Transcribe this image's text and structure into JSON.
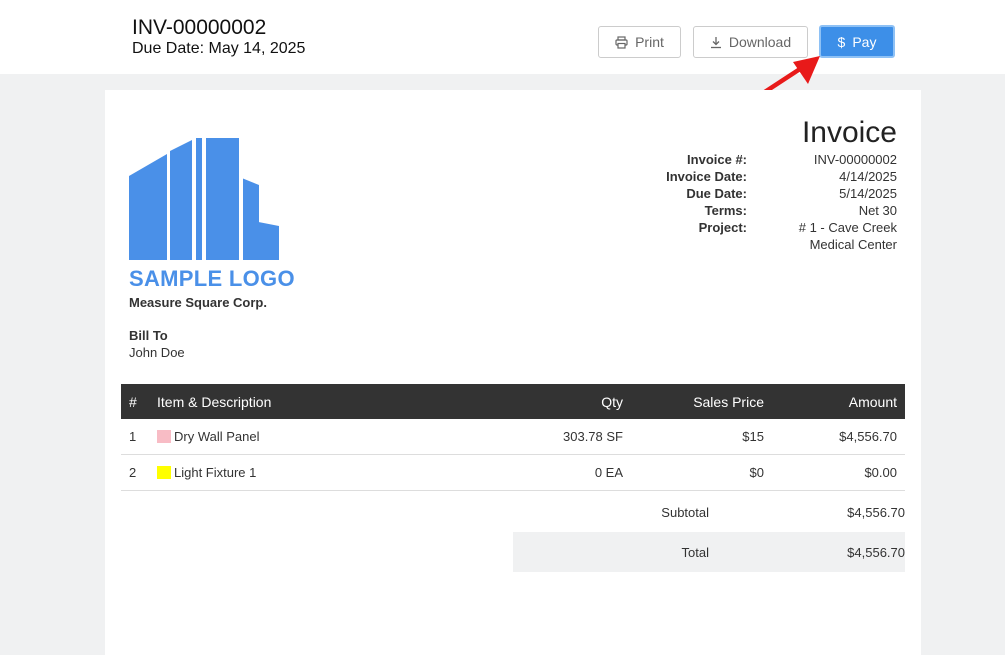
{
  "header": {
    "invoice_id": "INV-00000002",
    "due_date": "Due Date: May 14, 2025",
    "buttons": {
      "print": "Print",
      "download": "Download",
      "pay": "Pay"
    }
  },
  "icons": {
    "print": "printer-icon",
    "download": "download-icon",
    "pay": "dollar-icon"
  },
  "colors": {
    "primary": "#3d8fe8",
    "logo": "#4a90e8",
    "arrow": "#e81a1a",
    "table_header": "#333333"
  },
  "document": {
    "logo_text": "SAMPLE LOGO",
    "company": "Measure Square Corp.",
    "bill_to_label": "Bill To",
    "bill_to_name": "John Doe",
    "title": "Invoice",
    "meta": [
      {
        "label": "Invoice #:",
        "value": "INV-00000002"
      },
      {
        "label": "Invoice Date:",
        "value": "4/14/2025"
      },
      {
        "label": "Due Date:",
        "value": "5/14/2025"
      },
      {
        "label": "Terms:",
        "value": "Net 30"
      },
      {
        "label": "Project:",
        "value": "# 1 - Cave Creek"
      },
      {
        "label": "",
        "value": "Medical Center"
      }
    ]
  },
  "table": {
    "headers": [
      "#",
      "Item & Description",
      "Qty",
      "Sales Price",
      "Amount"
    ],
    "rows": [
      {
        "num": "1",
        "item": "Dry Wall Panel",
        "swatch": "#f8bcc5",
        "qty": "303.78 SF",
        "price": "$15",
        "amount": "$4,556.70"
      },
      {
        "num": "2",
        "item": "Light Fixture 1",
        "swatch": "#ffff00",
        "qty": "0 EA",
        "price": "$0",
        "amount": "$0.00"
      }
    ]
  },
  "totals": {
    "subtotal_label": "Subtotal",
    "subtotal_value": "$4,556.70",
    "total_label": "Total",
    "total_value": "$4,556.70"
  }
}
